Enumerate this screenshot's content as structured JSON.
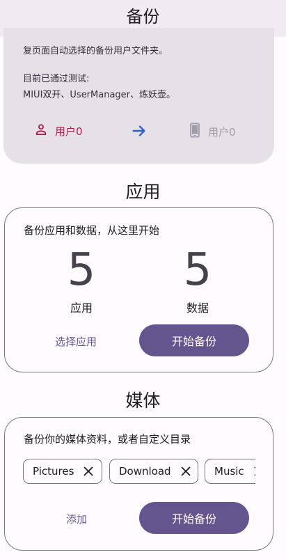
{
  "topbar": {
    "title": "备份"
  },
  "info": {
    "line1": "复页面自动选择的备份用户文件夹。",
    "line2": "目前已通过测试:",
    "line3": "MIUI双开、UserManager、炼妖壶。",
    "from_user": "用户0",
    "to_user": "用户0"
  },
  "apps": {
    "section_title": "应用",
    "description": "备份应用和数据，从这里开始",
    "apps_count": "5",
    "apps_label": "应用",
    "data_count": "5",
    "data_label": "数据",
    "select_button": "选择应用",
    "start_button": "开始备份"
  },
  "media": {
    "section_title": "媒体",
    "description": "备份你的媒体资料，或者自定义目录",
    "chips": [
      "Pictures",
      "Download",
      "Music"
    ],
    "add_button": "添加",
    "start_button": "开始备份"
  },
  "colors": {
    "accent": "#65558f",
    "user_from": "#ab1d45",
    "arrow": "#2e5fd1",
    "disabled": "#a09da6"
  }
}
